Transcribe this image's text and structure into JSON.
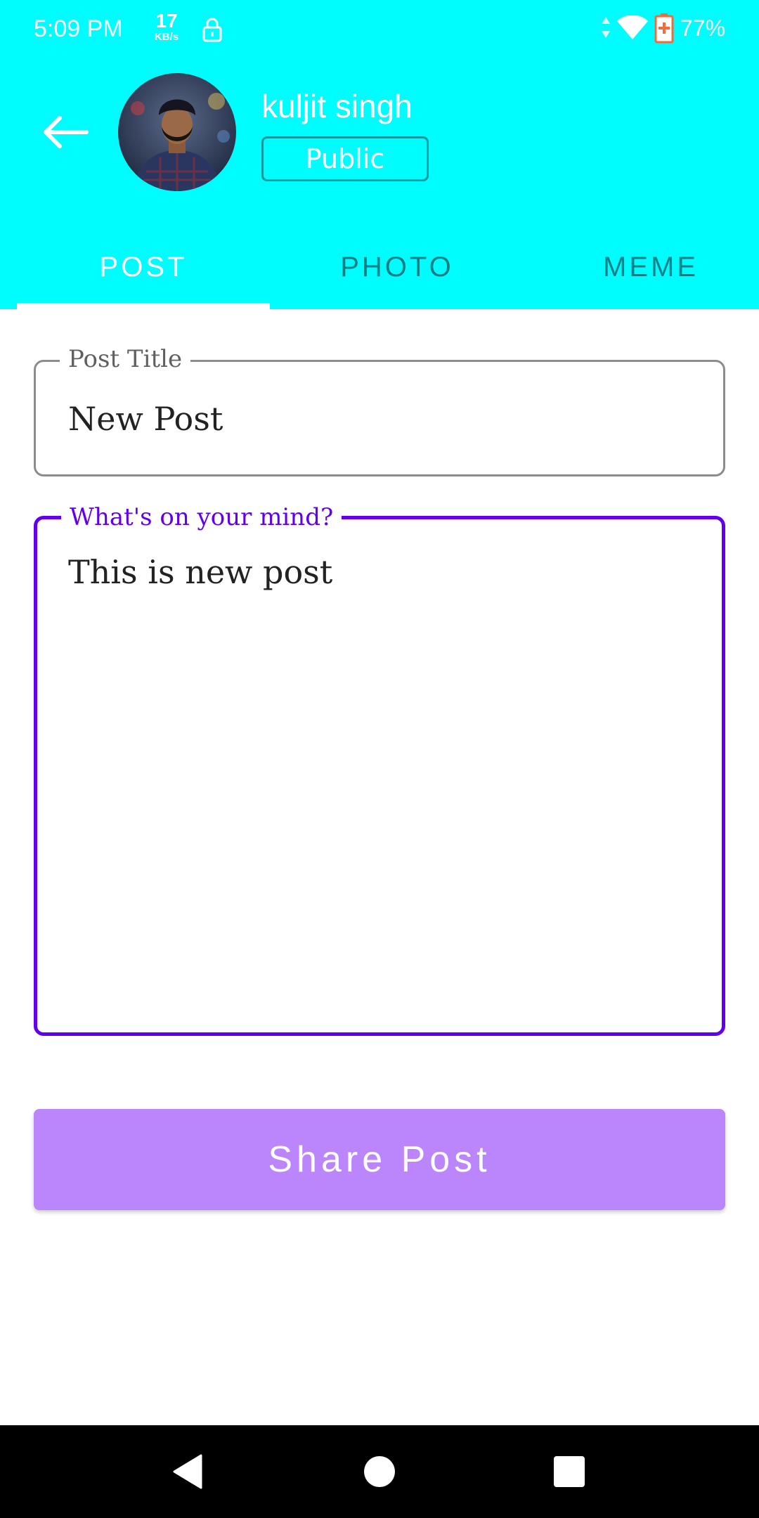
{
  "status_bar": {
    "time": "5:09 PM",
    "network_speed_value": "17",
    "network_speed_unit": "KB/s",
    "battery_percent": "77%",
    "icons": [
      "lock-icon",
      "data-arrows-icon",
      "wifi-icon",
      "battery-charging-icon"
    ]
  },
  "header": {
    "back_icon": "arrow-left-icon",
    "user_name": "kuljit singh",
    "privacy_label": "Public"
  },
  "tabs": [
    {
      "label": "POST",
      "selected": true
    },
    {
      "label": "PHOTO",
      "selected": false
    },
    {
      "label": "MEME",
      "selected": false
    }
  ],
  "form": {
    "title_label": "Post Title",
    "title_value": "New Post",
    "content_label": "What's on your mind?",
    "content_value": "This is new post"
  },
  "share_button_label": "Share Post",
  "nav_bar": {
    "icons": [
      "back-triangle-icon",
      "home-circle-icon",
      "recents-square-icon"
    ]
  },
  "colors": {
    "header_bg": "#00fdfd",
    "accent": "#6200ee",
    "button_bg": "#bb86fc",
    "tab_inactive": "#0a7f86"
  }
}
